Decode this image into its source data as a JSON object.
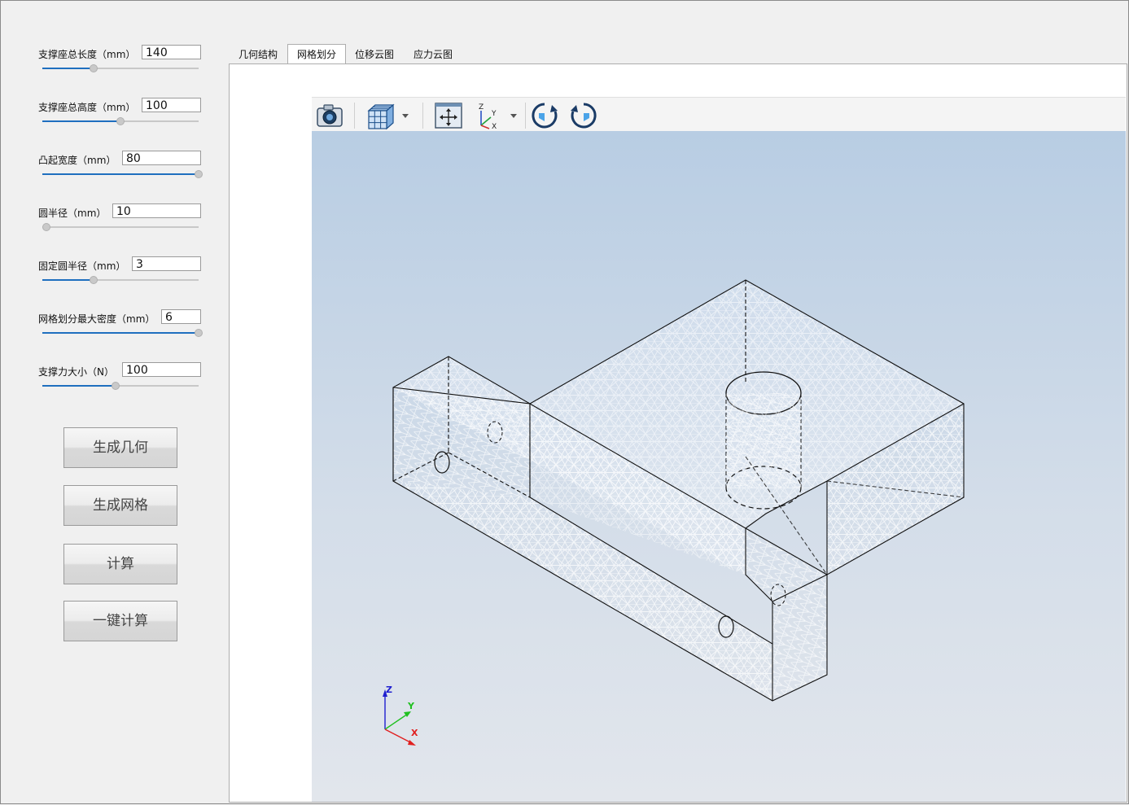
{
  "params": [
    {
      "label": "支撑座总长度（mm）",
      "value": "140",
      "fill_fraction": 0.33
    },
    {
      "label": "支撑座总高度（mm）",
      "value": "100",
      "fill_fraction": 0.5
    },
    {
      "label": "凸起宽度（mm）",
      "value": "80",
      "fill_fraction": 1.0
    },
    {
      "label": "圆半径（mm）",
      "value": "10",
      "fill_fraction": 0.0
    },
    {
      "label": "固定圆半径（mm）",
      "value": "3",
      "fill_fraction": 0.33
    },
    {
      "label": "网格划分最大密度（mm）",
      "value": "6",
      "fill_fraction": 1.0
    },
    {
      "label": "支撑力大小（N）",
      "value": "100",
      "fill_fraction": 0.47
    }
  ],
  "buttons": {
    "generate_geometry": "生成几何",
    "generate_mesh": "生成网格",
    "compute": "计算",
    "one_click_compute": "一键计算"
  },
  "tabs": [
    {
      "label": "几何结构",
      "active": false
    },
    {
      "label": "网格划分",
      "active": true
    },
    {
      "label": "位移云图",
      "active": false
    },
    {
      "label": "应力云图",
      "active": false
    }
  ],
  "toolbar": {
    "icons": [
      "camera-icon",
      "mesh-display-icon",
      "fit-all-icon",
      "axes-view-icon",
      "rotate-cw-icon",
      "rotate-ccw-icon"
    ]
  },
  "axes": {
    "x": "X",
    "y": "Y",
    "z": "Z",
    "x_color": "#e02020",
    "y_color": "#20c020",
    "z_color": "#2020d0"
  },
  "colors": {
    "accent": "#1f6fbf",
    "viewport_top": "#b8cde3",
    "viewport_bottom": "#e2e6ec"
  }
}
